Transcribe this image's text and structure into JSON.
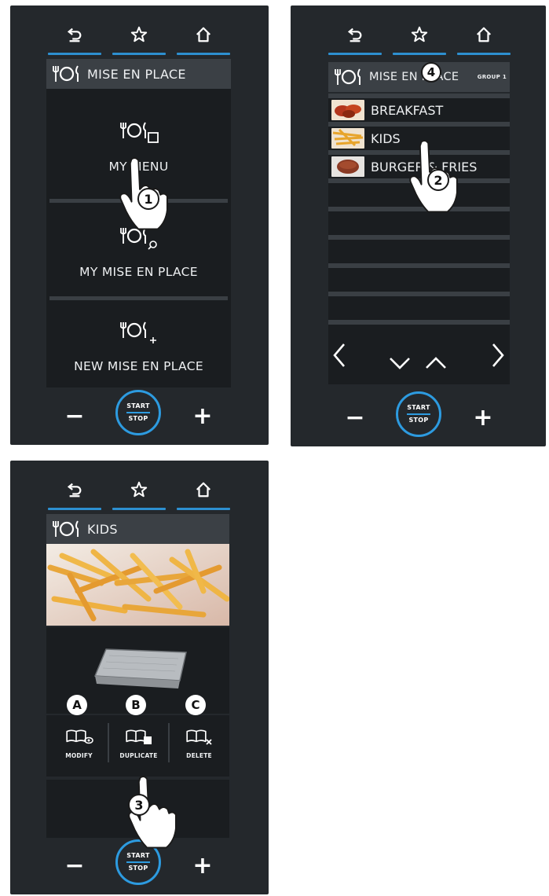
{
  "nav": {
    "back_icon": "back-arrow-icon",
    "fav_icon": "star-icon",
    "home_icon": "home-icon",
    "accent": "#2d8fd0"
  },
  "controls": {
    "minus": "−",
    "plus": "+",
    "start": "START",
    "stop": "STOP"
  },
  "screen1": {
    "title": "MISE EN PLACE",
    "items": [
      {
        "label": "MY MENU",
        "icon": "menu-book-icon"
      },
      {
        "label": "MY MISE EN PLACE",
        "icon": "search-mise-icon"
      },
      {
        "label": "NEW MISE EN PLACE",
        "icon": "add-mise-icon"
      }
    ],
    "step": "1"
  },
  "screen2": {
    "title": "MISE EN PLACE",
    "group": "GROUP 1",
    "rows": [
      {
        "label": "BREAKFAST",
        "thumb": "breakfast-thumb"
      },
      {
        "label": "KIDS",
        "thumb": "fries-thumb"
      },
      {
        "label": "BURGER & FRIES",
        "thumb": "burger-thumb"
      }
    ],
    "steps": [
      "4",
      "2"
    ]
  },
  "screen3": {
    "title": "KIDS",
    "letters": [
      "A",
      "B",
      "C"
    ],
    "actions": [
      {
        "label": "MODIFY",
        "icon": "book-eye-icon"
      },
      {
        "label": "DUPLICATE",
        "icon": "book-copy-icon"
      },
      {
        "label": "DELETE",
        "icon": "book-delete-icon"
      }
    ],
    "step": "3"
  }
}
